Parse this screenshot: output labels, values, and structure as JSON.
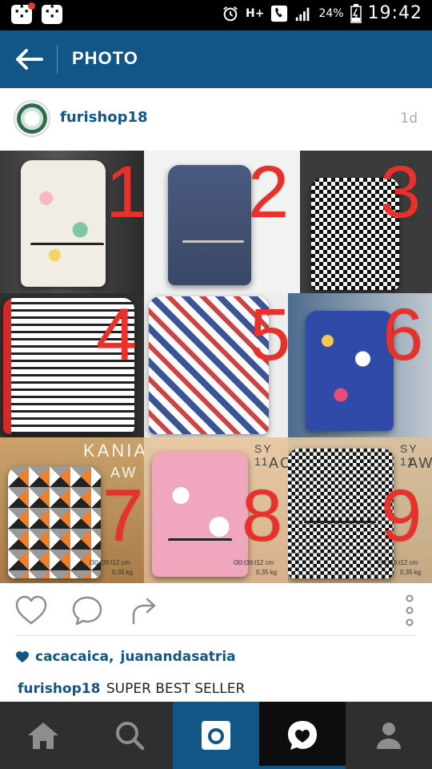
{
  "status_bar": {
    "battery_percent": "24%",
    "network": "H+",
    "time": "19:42"
  },
  "app_bar": {
    "title": "PHOTO"
  },
  "post": {
    "username": "furishop18",
    "time_ago": "1d",
    "collage": {
      "numbers": [
        "1",
        "2",
        "3",
        "4",
        "5",
        "6",
        "7",
        "8",
        "9"
      ],
      "labels": {
        "kania": "KANIA",
        "aw_left": "AW",
        "sy_mid": "SY 11",
        "ac": "AC",
        "sy_right": "SY 11",
        "aw_right": "AW",
        "dims_mid": "l30:t39:t12 cm",
        "weight_mid": "0,35 kg",
        "dims_left": "l30:t39:t12 cm",
        "weight_left": "0,35 kg",
        "dims_right": "l30:t39:t12 cm",
        "weight_right": "0,35 kg"
      }
    },
    "likes": [
      "cacacaica",
      "juanandasatria"
    ],
    "caption_user": "furishop18",
    "caption_text": "SUPER BEST SELLER"
  },
  "colors": {
    "brand_blue": "#125688",
    "number_red": "#e8312a",
    "nav_bg": "#2f2f2f"
  },
  "icons": {
    "back": "arrow-left-icon",
    "like": "heart-icon",
    "comment": "comment-icon",
    "share": "share-icon",
    "more": "more-vertical-icon",
    "nav": [
      "home-icon",
      "search-icon",
      "camera-icon",
      "activity-heart-icon",
      "profile-icon"
    ]
  }
}
